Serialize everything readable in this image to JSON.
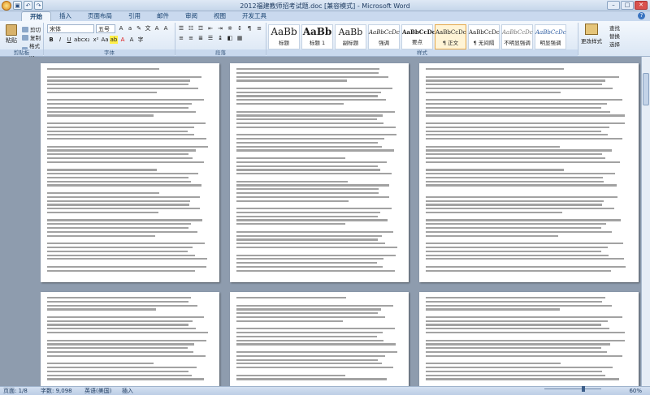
{
  "window": {
    "title": "2012福建教师招考试题.doc [兼容模式] - Microsoft Word"
  },
  "tabs": [
    "开始",
    "插入",
    "页面布局",
    "引用",
    "邮件",
    "审阅",
    "视图",
    "开发工具"
  ],
  "ribbon": {
    "clipboard": {
      "paste": "粘贴",
      "cut": "剪切",
      "copy": "复制",
      "format_painter": "格式刷",
      "label": "剪贴板"
    },
    "font": {
      "name": "宋体",
      "size": "五号",
      "label": "字体"
    },
    "paragraph": {
      "label": "段落"
    },
    "styles": {
      "label": "样式",
      "items": [
        {
          "preview": "AaBb",
          "name": "标题"
        },
        {
          "preview": "AaBb",
          "name": "标题 1"
        },
        {
          "preview": "AaBb",
          "name": "副标题"
        },
        {
          "preview": "AaBbCcDc",
          "name": "强调"
        },
        {
          "preview": "AaBbCcDc",
          "name": "要点"
        },
        {
          "preview": "AaBbCcDc",
          "name": "¶ 正文"
        },
        {
          "preview": "AaBbCcDc",
          "name": "¶ 无间隔"
        },
        {
          "preview": "AaBbCcDc",
          "name": "不明显强调"
        },
        {
          "preview": "AaBbCcDc",
          "name": "明显强调"
        },
        {
          "preview": "AaBbCcDc",
          "name": "引用"
        },
        {
          "preview": "AaBbCcDc",
          "name": "明显引用"
        }
      ],
      "change_styles": "更改样式"
    },
    "editing": {
      "find": "查找",
      "replace": "替换",
      "select": "选择",
      "label": "编辑"
    }
  },
  "status": {
    "page": "页面: 1/8",
    "words": "字数: 9,098",
    "language": "英语(美国)",
    "mode": "插入",
    "zoom": "60%"
  }
}
